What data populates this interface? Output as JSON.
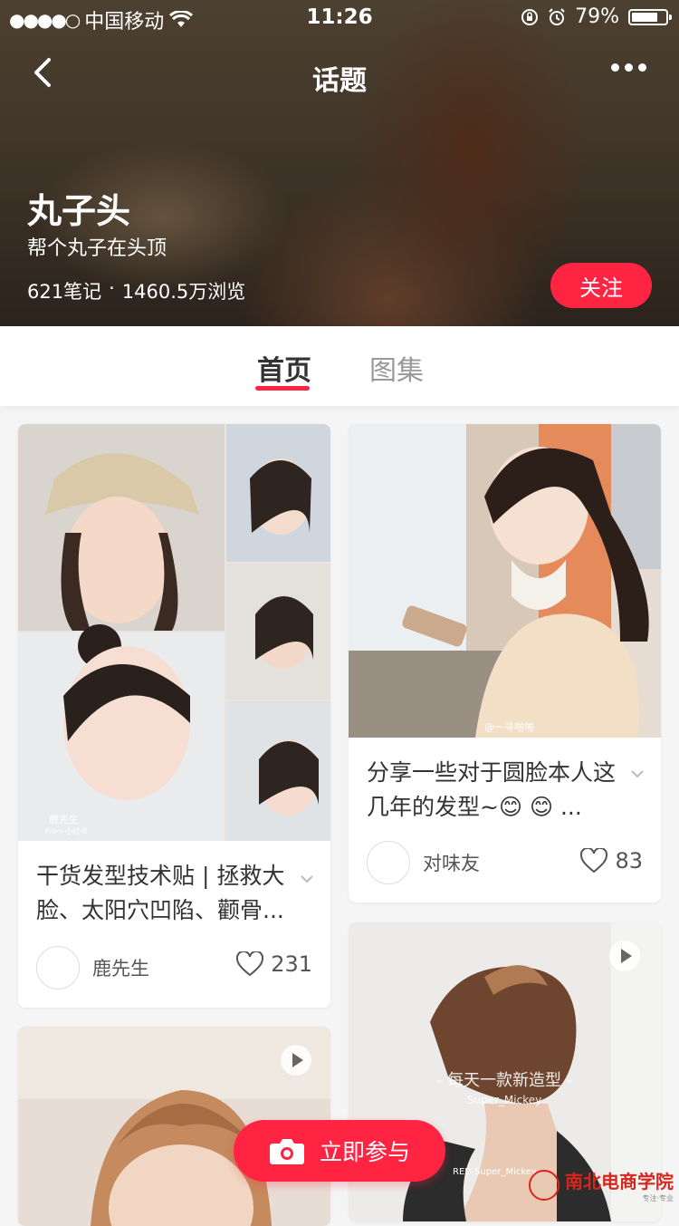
{
  "status_bar": {
    "carrier": "中国移动",
    "signal": "●●●●○",
    "time": "11:26",
    "battery": "79%",
    "battery_level": 0.79
  },
  "nav": {
    "title": "话题"
  },
  "topic": {
    "title": "丸子头",
    "subtitle": "帮个丸子在头顶",
    "notes": "621笔记",
    "separator": "·",
    "views": "1460.5万浏览",
    "follow_label": "关注"
  },
  "tabs": [
    {
      "label": "首页",
      "active": true
    },
    {
      "label": "图集",
      "active": false
    }
  ],
  "feed": [
    {
      "title": "干货发型技术贴 | 拯救大脸、太阳穴凹陷、颧骨...",
      "author": "鹿先生",
      "likes": "231",
      "img_caption": "鹿先生",
      "img_caption2": "From 小红书"
    },
    {
      "title": "分享一些对于圆脸本人这几年的发型~😊 😊 ...",
      "author": "对味友",
      "likes": "83",
      "img_caption": "@一寻啪啪"
    },
    {
      "img_caption": "- 每天一款新造型 -",
      "img_caption2": "Super_Mickey",
      "img_caption3": "RED Super_Mickey"
    }
  ],
  "join_label": "立即参与",
  "watermark": {
    "text": "南北电商学院",
    "tagline": "专注·专业"
  },
  "colors": {
    "accent": "#ff2442",
    "watermark": "#d9261c"
  }
}
